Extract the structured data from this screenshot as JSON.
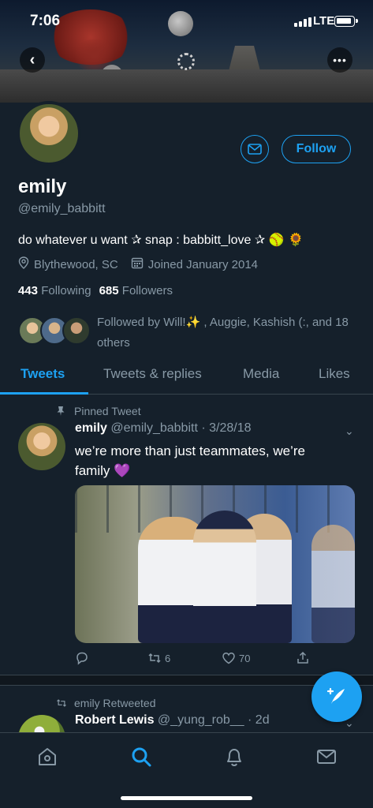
{
  "status_bar": {
    "time": "7:06",
    "network": "LTE"
  },
  "profile": {
    "display_name": "emily",
    "handle": "@emily_babbitt",
    "bio": "do whatever u want ✰ snap : babbitt_love ✰ 🥎 🌻",
    "location": "Blythewood, SC",
    "joined": "Joined January 2014",
    "following_count": "443",
    "following_label": "Following",
    "followers_count": "685",
    "followers_label": "Followers",
    "followed_by": "Followed by Will!✨ , Auggie, Kashish (:, and 18 others"
  },
  "buttons": {
    "follow_label": "Follow"
  },
  "tabs": [
    {
      "label": "Tweets",
      "active": true
    },
    {
      "label": "Tweets & replies",
      "active": false
    },
    {
      "label": "Media",
      "active": false
    },
    {
      "label": "Likes",
      "active": false
    }
  ],
  "tweets": [
    {
      "context": "Pinned Tweet",
      "author_name": "emily",
      "author_handle": "@emily_babbitt",
      "date": "· 3/28/18",
      "text": "we’re more than just teammates, we’re family 💜",
      "media_text": "BBITT 0",
      "retweets": "6",
      "likes": "70"
    },
    {
      "context": "emily Retweeted",
      "author_name": "Robert Lewis",
      "author_handle": "@_yung_rob__",
      "date": "· 2d"
    }
  ],
  "colors": {
    "accent": "#1da1f2",
    "background": "#15202b",
    "secondary_text": "#8899a6",
    "divider": "#38444d"
  },
  "icons": [
    "back-arrow-icon",
    "more-icon",
    "loading-spinner-icon",
    "envelope-icon",
    "location-pin-icon",
    "calendar-icon",
    "pin-icon",
    "chevron-down-icon",
    "reply-icon",
    "retweet-icon",
    "like-icon",
    "share-icon",
    "compose-icon",
    "home-icon",
    "search-icon",
    "notifications-icon",
    "messages-icon"
  ]
}
